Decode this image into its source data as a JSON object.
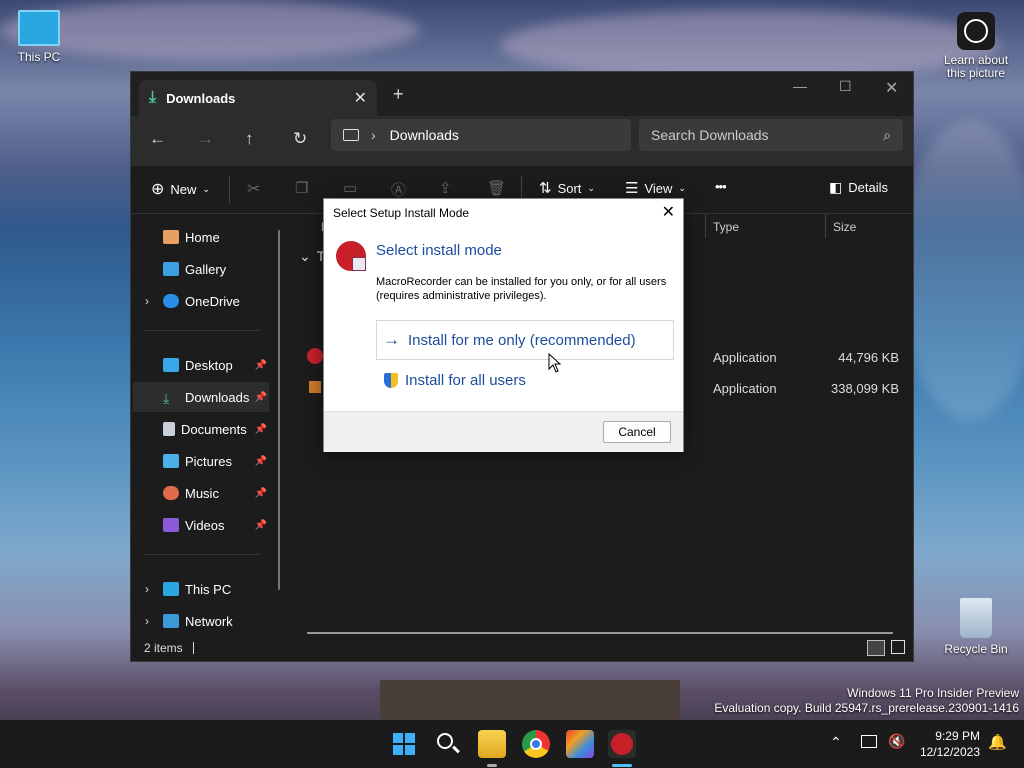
{
  "desktop": {
    "this_pc_label": "This PC",
    "learn_label": "Learn about this picture",
    "recycle_label": "Recycle Bin"
  },
  "explorer": {
    "tab_title": "Downloads",
    "tab_close": "✕",
    "new_tab": "+",
    "address_path": "Downloads",
    "search_placeholder": "Search Downloads",
    "commands": {
      "new": "New",
      "sort": "Sort",
      "view": "View",
      "more": "•••",
      "details": "Details"
    },
    "sidebar": {
      "items": [
        {
          "label": "Home"
        },
        {
          "label": "Gallery"
        },
        {
          "label": "OneDrive"
        },
        {
          "label": "Desktop"
        },
        {
          "label": "Downloads"
        },
        {
          "label": "Documents"
        },
        {
          "label": "Pictures"
        },
        {
          "label": "Music"
        },
        {
          "label": "Videos"
        },
        {
          "label": "This PC"
        },
        {
          "label": "Network"
        }
      ]
    },
    "columns": {
      "name": "N",
      "type": "Type",
      "size": "Size"
    },
    "group_header": "To",
    "files": [
      {
        "type": "Application",
        "size": "44,796 KB"
      },
      {
        "type": "Application",
        "size": "338,099 KB"
      }
    ],
    "status": "2 items"
  },
  "dialog": {
    "title": "Select Setup Install Mode",
    "heading": "Select install mode",
    "description": "MacroRecorder can be installed for you only, or for all users (requires administrative privileges).",
    "option_me": "Install for me only (recommended)",
    "option_all": "Install for all users",
    "cancel": "Cancel"
  },
  "watermark": {
    "line1": "Windows 11 Pro Insider Preview",
    "line2": "Evaluation copy. Build 25947.rs_prerelease.230901-1416"
  },
  "taskbar": {
    "time": "9:29 PM",
    "date": "12/12/2023"
  },
  "colors": {
    "accent": "#1a4e9c",
    "downloads_icon": "#4cc2a0"
  }
}
